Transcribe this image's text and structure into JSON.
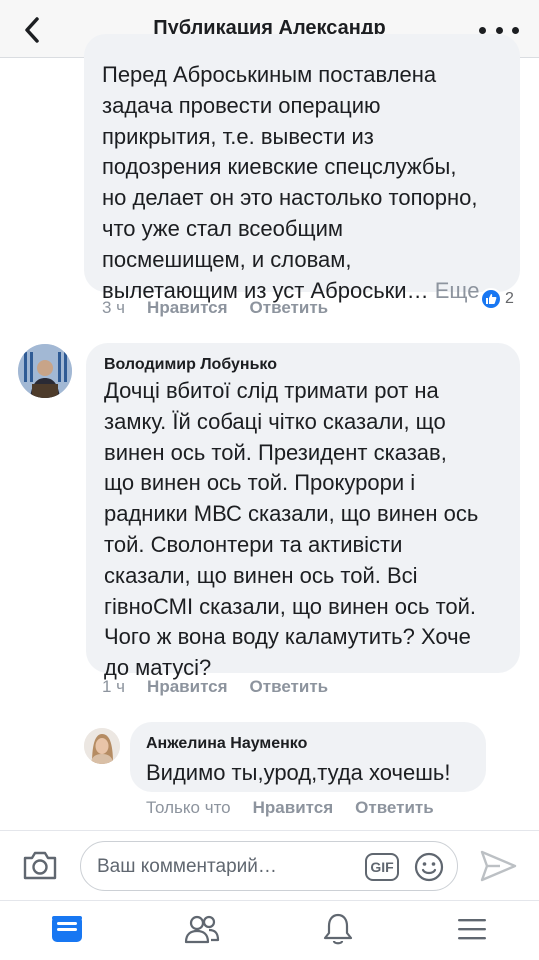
{
  "header": {
    "title": "Публикация Александр",
    "back_icon": "chevron-left-icon",
    "more_icon": "more-dots-icon"
  },
  "comments": [
    {
      "author": "",
      "lines": [
        "Перед Аброськиным поставлена",
        "задача провести операцию",
        "прикрытия, т.е. вывести из",
        "подозрения киевские спецслужбы,",
        "но делает он это настолько топорно,",
        "что уже стал всеобщим",
        "посмешищем, и словам,",
        "вылетающим из уст Аброськи…"
      ],
      "more_label": "Еще",
      "time": "3 ч",
      "like_label": "Нравится",
      "reply_label": "Ответить",
      "reaction_count": "2"
    },
    {
      "author": "Володимир Лобунько",
      "lines": [
        "Дочці вбитої слід тримати рот на",
        "замку. Їй собаці чітко сказали, що",
        "винен ось той. Президент сказав,",
        "що винен ось той. Прокурори і",
        "радники МВС сказали, що винен ось",
        "той. Сволонтери та активісти",
        "сказали, що винен ось той. Всі",
        "гівноСМІ сказали, що винен ось той.",
        "Чого ж вона воду каламутить? Хоче",
        "до матусі?"
      ],
      "time": "1 ч",
      "like_label": "Нравится",
      "reply_label": "Ответить"
    },
    {
      "author": "Анжелина Науменко",
      "lines": [
        "Видимо ты,урод,туда хочешь!"
      ],
      "time": "Только что",
      "like_label": "Нравится",
      "reply_label": "Ответить"
    }
  ],
  "composer": {
    "placeholder": "Ваш комментарий…",
    "gif_label": "GIF"
  },
  "nav": {
    "items": [
      "news-feed-icon",
      "friends-icon",
      "notifications-icon",
      "menu-icon"
    ]
  },
  "colors": {
    "accent": "#1877f2",
    "bubble": "#f0f2f5",
    "meta": "#8d949e"
  }
}
